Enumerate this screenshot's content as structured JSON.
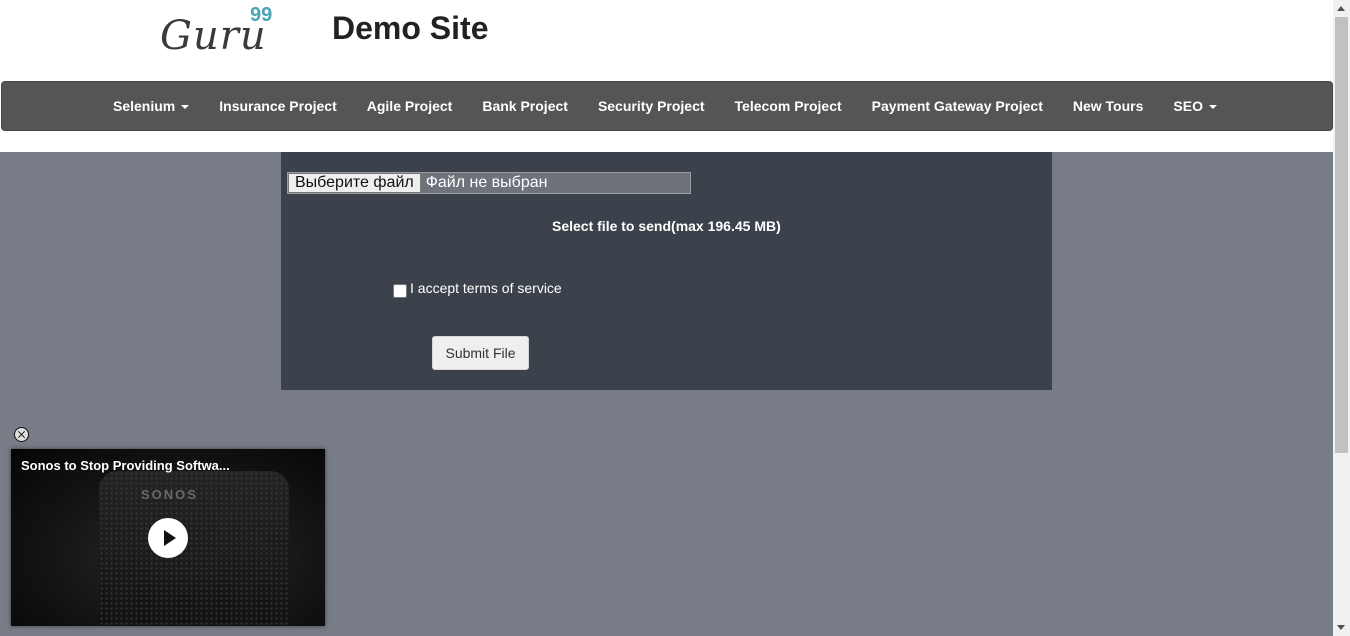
{
  "header": {
    "logo_word": "Guru",
    "logo_number": "99",
    "site_title": "Demo Site"
  },
  "nav": {
    "items": [
      {
        "label": "Selenium",
        "dropdown": true
      },
      {
        "label": "Insurance Project",
        "dropdown": false
      },
      {
        "label": "Agile Project",
        "dropdown": false
      },
      {
        "label": "Bank Project",
        "dropdown": false
      },
      {
        "label": "Security Project",
        "dropdown": false
      },
      {
        "label": "Telecom Project",
        "dropdown": false
      },
      {
        "label": "Payment Gateway Project",
        "dropdown": false
      },
      {
        "label": "New Tours",
        "dropdown": false
      },
      {
        "label": "SEO",
        "dropdown": true
      }
    ]
  },
  "upload_form": {
    "file_button_label": "Выберите файл",
    "file_status": "Файл не выбран",
    "send_label": "Select file to send(max 196.45 MB)",
    "terms_label": "I accept terms of service",
    "terms_checked": false,
    "submit_label": "Submit File"
  },
  "video_popup": {
    "title": "Sonos to Stop Providing Softwa...",
    "brand_label": "SONOS"
  },
  "colors": {
    "navbar": "#555555",
    "page_background": "#787c86",
    "panel": "#3c424b",
    "logo_accent": "#4ba3b4"
  },
  "icons": {
    "close": "close-icon",
    "play": "play-icon",
    "caret": "caret-down-icon"
  }
}
